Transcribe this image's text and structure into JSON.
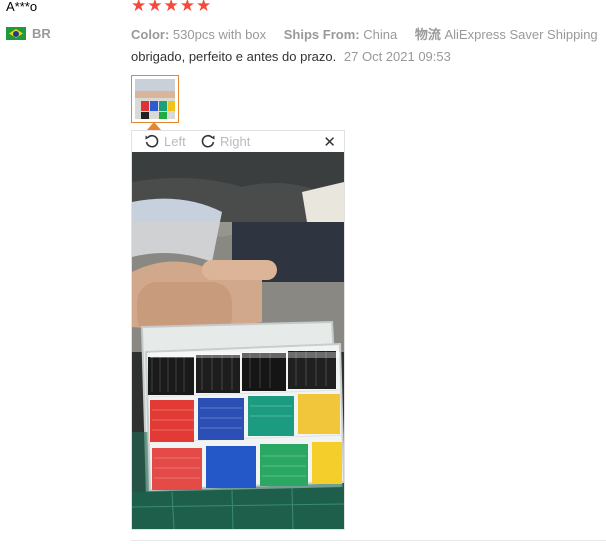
{
  "reviewer": {
    "name": "A***o",
    "country_code": "BR",
    "flag_icon": "brazil-flag-icon"
  },
  "rating": {
    "stars": 5,
    "max": 5,
    "color": "#f44a3a"
  },
  "meta": {
    "color_label": "Color:",
    "color_value": "530pcs with box",
    "ships_label": "Ships From:",
    "ships_value": "China",
    "shipping_label": "物流",
    "shipping_value": "AliExpress Saver Shipping"
  },
  "review": {
    "text": "obrigado, perfeito e antes do prazo.",
    "date": "27 Oct 2021 09:53"
  },
  "viewer": {
    "rotate_left_label": "Left",
    "rotate_right_label": "Right",
    "close_icon": "close-icon",
    "accent": "#e5872f"
  }
}
